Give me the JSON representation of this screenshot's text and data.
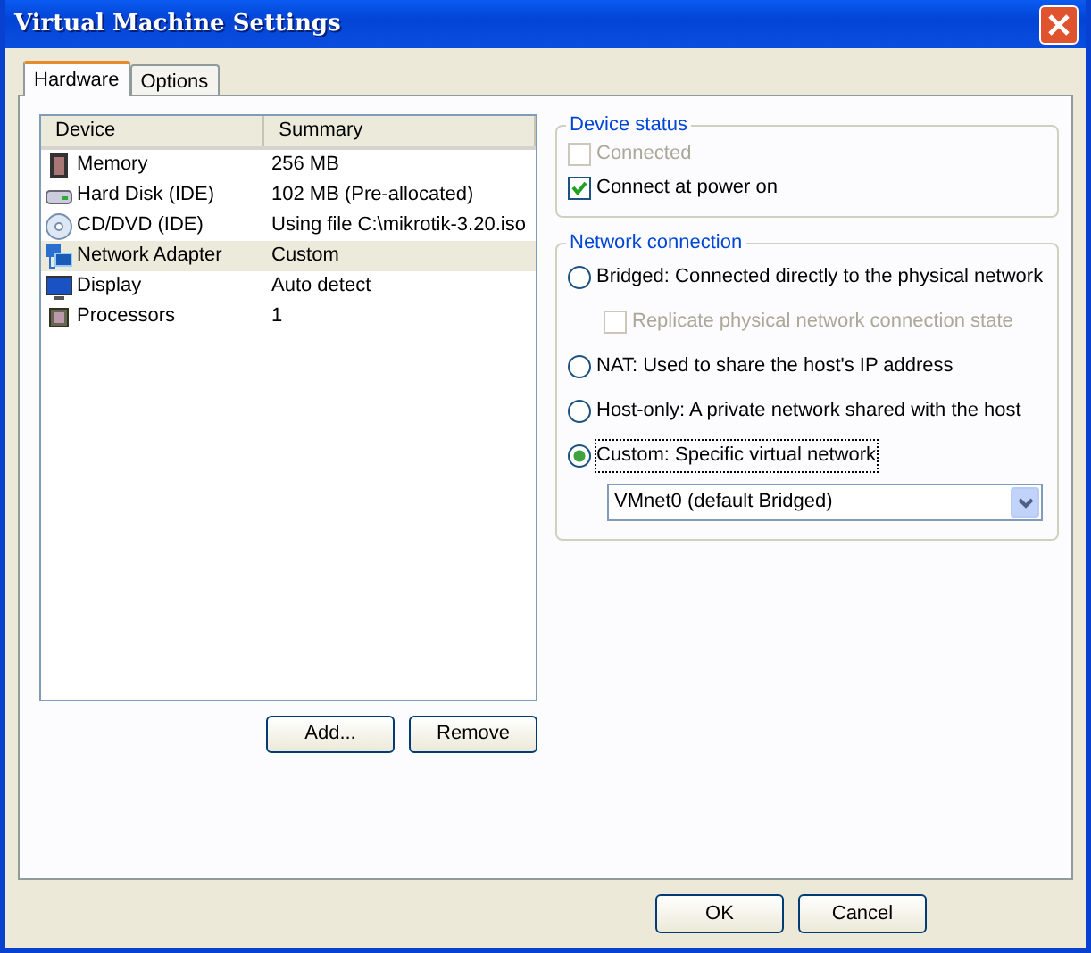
{
  "window": {
    "title": "Virtual Machine Settings"
  },
  "tabs": [
    {
      "label": "Hardware",
      "selected": true
    },
    {
      "label": "Options",
      "selected": false
    }
  ],
  "devices": {
    "columns": [
      "Device",
      "Summary"
    ],
    "rows": [
      {
        "kind": "memory",
        "device": "Memory",
        "summary": "256 MB",
        "selected": false
      },
      {
        "kind": "disk",
        "device": "Hard Disk (IDE)",
        "summary": "102 MB (Pre-allocated)",
        "selected": false
      },
      {
        "kind": "cd",
        "device": "CD/DVD (IDE)",
        "summary": "Using file C:\\mikrotik-3.20.iso",
        "selected": false
      },
      {
        "kind": "network",
        "device": "Network Adapter",
        "summary": "Custom",
        "selected": true
      },
      {
        "kind": "display",
        "device": "Display",
        "summary": "Auto detect",
        "selected": false
      },
      {
        "kind": "processor",
        "device": "Processors",
        "summary": "1",
        "selected": false
      }
    ],
    "buttons": [
      "Add...",
      "Remove"
    ]
  },
  "device_status": {
    "title": "Device status",
    "options": [
      {
        "label": "Connected",
        "checked": false,
        "disabled": true
      },
      {
        "label": "Connect at power on",
        "checked": true,
        "disabled": false
      }
    ]
  },
  "network_connection": {
    "title": "Network connection",
    "options": [
      {
        "kind": "radio",
        "label": "Bridged: Connected directly to the physical network",
        "selected": false,
        "disabled": false
      },
      {
        "kind": "checkbox",
        "label": "Replicate physical network connection state",
        "checked": false,
        "disabled": true
      },
      {
        "kind": "radio",
        "label": "NAT: Used to share the host's IP address",
        "selected": false,
        "disabled": false
      },
      {
        "kind": "radio",
        "label": "Host-only: A private network shared with the host",
        "selected": false,
        "disabled": false
      },
      {
        "kind": "radio",
        "label": "Custom: Specific virtual network",
        "selected": true,
        "disabled": false
      }
    ],
    "dropdown": {
      "value": "VMnet0 (default Bridged)"
    }
  },
  "footer_buttons": [
    "OK",
    "Cancel"
  ]
}
